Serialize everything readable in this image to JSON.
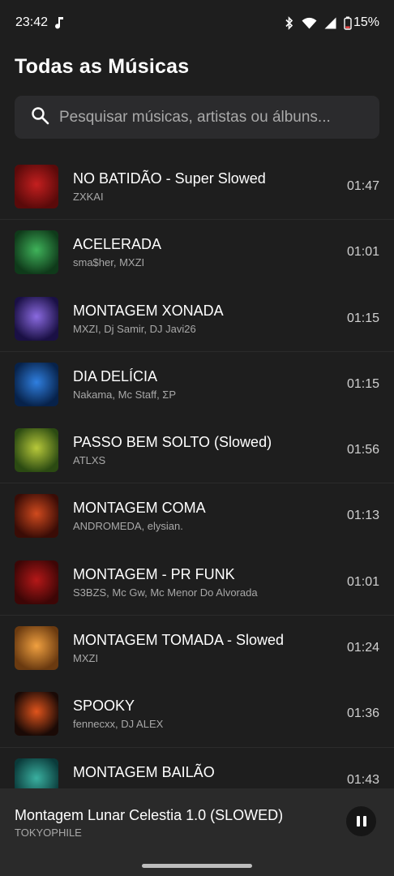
{
  "status": {
    "time": "23:42",
    "battery": "15%",
    "icons": [
      "music-note-icon",
      "bluetooth-icon",
      "wifi-icon",
      "signal-icon",
      "battery-icon"
    ]
  },
  "header": {
    "title": "Todas as Músicas"
  },
  "search": {
    "placeholder": "Pesquisar músicas, artistas ou álbuns..."
  },
  "songs": [
    {
      "title": "NO BATIDÃO - Super Slowed",
      "artist": "ZXKAI",
      "duration": "01:47",
      "cover": [
        "#5a0a0a",
        "#c41f1f"
      ]
    },
    {
      "title": "ACELERADA",
      "artist": "sma$her, MXZI",
      "duration": "01:01",
      "cover": [
        "#0f3a1a",
        "#3fb35a"
      ]
    },
    {
      "title": "MONTAGEM XONADA",
      "artist": "MXZI, Dj Samir, DJ Javi26",
      "duration": "01:15",
      "cover": [
        "#1a1045",
        "#8a6ae0"
      ]
    },
    {
      "title": "DIA DELÍCIA",
      "artist": "Nakama, Mc Staff, ΣP",
      "duration": "01:15",
      "cover": [
        "#07224a",
        "#2f7fe0"
      ]
    },
    {
      "title": "PASSO BEM SOLTO (Slowed)",
      "artist": "ATLXS",
      "duration": "01:56",
      "cover": [
        "#2b4a12",
        "#b8c93a"
      ]
    },
    {
      "title": "MONTAGEM COMA",
      "artist": "ANDROMEDA, elysian.",
      "duration": "01:13",
      "cover": [
        "#3a0c06",
        "#d04a1e"
      ]
    },
    {
      "title": "MONTAGEM - PR FUNK",
      "artist": "S3BZS, Mc Gw, Mc Menor Do Alvorada",
      "duration": "01:01",
      "cover": [
        "#3d0606",
        "#b51818"
      ]
    },
    {
      "title": "MONTAGEM TOMADA - Slowed",
      "artist": "MXZI",
      "duration": "01:24",
      "cover": [
        "#6a3a10",
        "#f0a040"
      ]
    },
    {
      "title": "SPOOKY",
      "artist": "fennecxx, DJ ALEX",
      "duration": "01:36",
      "cover": [
        "#1a0a06",
        "#e0541c"
      ]
    },
    {
      "title": "MONTAGEM BAILÃO",
      "artist": "",
      "duration": "01:43",
      "cover": [
        "#0a3a3a",
        "#3ab0a0"
      ]
    }
  ],
  "now_playing": {
    "title": "Montagem Lunar Celestia 1.0 (SLOWED)",
    "artist": "TOKYOPHILE",
    "state": "playing"
  }
}
